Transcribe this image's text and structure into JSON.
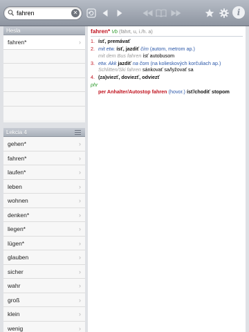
{
  "search": {
    "value": "fahren"
  },
  "toolbar": {
    "icons": [
      "refresh-icon",
      "back-icon",
      "forward-icon",
      "rewind-icon",
      "book-icon",
      "fast-forward-icon",
      "star-icon",
      "gear-icon",
      "info-icon"
    ],
    "info_label": "i"
  },
  "history": {
    "title": "Hesla",
    "items": [
      "fahren*"
    ]
  },
  "lesson": {
    "title": "Lekcia 4",
    "items": [
      "gehen*",
      "fahren*",
      "laufen*",
      "leben",
      "wohnen",
      "denken*",
      "liegen*",
      "lügen*",
      "glauben",
      "sicher",
      "wahr",
      "groß",
      "klein",
      "wenig"
    ]
  },
  "entry": {
    "headword": "fahren*",
    "pos": "Vb",
    "forms": "(fährt, u, i./h. a)",
    "senses": [
      {
        "num": "1.",
        "text": "ísť, premávať"
      },
      {
        "num": "2.",
        "l1": "mit etw.",
        "l2": "ísť, jazdiť",
        "l3": "čím",
        "l4": "(autom, metrom ap.)",
        "ex_de": "mit dem Bus fahren",
        "ex_sk": "ísť autobusom"
      },
      {
        "num": "3.",
        "l1": "etw. Akk",
        "l2": "jazdiť",
        "l3": "na čom",
        "l4": "(na kolieskových korčuliach ap.)",
        "ex_de": "Schlitten/Ski fahren",
        "ex_sk": "sánkovať sa/lyžovať sa"
      },
      {
        "num": "4.",
        "text": "(za)viezť, doviezť, odviezť"
      }
    ],
    "phr_label": "phr",
    "phrase": {
      "de": "per Anhalter/Autostop fahren",
      "note": "(hovor.)",
      "sk": "ísť/chodiť stopom"
    }
  },
  "colors": {
    "headword": "#c0121e",
    "grammar": "#2a9a2a",
    "context": "#2956a8"
  }
}
